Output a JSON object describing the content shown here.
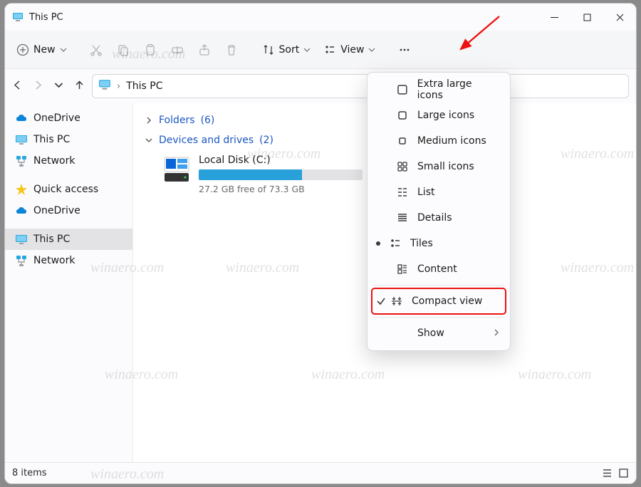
{
  "titlebar": {
    "title": "This PC"
  },
  "toolbar": {
    "new_label": "New",
    "sort_label": "Sort",
    "view_label": "View"
  },
  "address": {
    "crumb": "This PC"
  },
  "sidebar": {
    "items": [
      {
        "label": "OneDrive",
        "icon": "cloud-icon",
        "color": "#0a84d6"
      },
      {
        "label": "This PC",
        "icon": "monitor-icon",
        "color": "#1e9ad6"
      },
      {
        "label": "Network",
        "icon": "network-icon",
        "color": "#1e9ad6"
      },
      {
        "label": "Quick access",
        "icon": "star-icon",
        "color": "#f5c518"
      },
      {
        "label": "OneDrive",
        "icon": "cloud-icon",
        "color": "#0a84d6"
      },
      {
        "label": "This PC",
        "icon": "monitor-icon",
        "color": "#1e9ad6",
        "selected": true
      },
      {
        "label": "Network",
        "icon": "network-icon",
        "color": "#1e9ad6"
      }
    ]
  },
  "groups": {
    "folders": {
      "label": "Folders",
      "count": "(6)",
      "expanded": false
    },
    "drives": {
      "label": "Devices and drives",
      "count": "(2)",
      "expanded": true
    }
  },
  "drive": {
    "name": "Local Disk (C:)",
    "subtitle": "27.2 GB free of 73.3 GB",
    "fill_percent": 63
  },
  "view_menu": {
    "items": [
      {
        "label": "Extra large icons",
        "icon": "xl-icons-icon"
      },
      {
        "label": "Large icons",
        "icon": "lg-icons-icon"
      },
      {
        "label": "Medium icons",
        "icon": "md-icons-icon"
      },
      {
        "label": "Small icons",
        "icon": "sm-icons-icon"
      },
      {
        "label": "List",
        "icon": "list-lines-icon"
      },
      {
        "label": "Details",
        "icon": "details-lines-icon"
      },
      {
        "label": "Tiles",
        "icon": "tiles-icon",
        "selected": true
      },
      {
        "label": "Content",
        "icon": "content-icon"
      }
    ],
    "compact": {
      "label": "Compact view",
      "checked": true
    },
    "show": {
      "label": "Show"
    }
  },
  "statusbar": {
    "text": "8 items"
  },
  "watermark": "winaero.com"
}
